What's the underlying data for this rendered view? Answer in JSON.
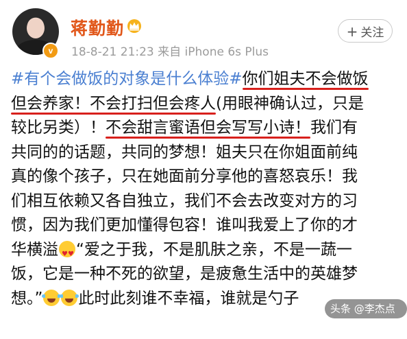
{
  "post": {
    "user_name": "蒋勤勤",
    "verified_badge": "v",
    "crown_icon": "crown-icon",
    "meta": "18-8-21 21:23  来自 iPhone 6s Plus",
    "follow_label": "关注",
    "follow_plus": "+",
    "content": {
      "l1_tag": "#有个会做饭的对象是什么体验#",
      "l1_ul": "你们姐夫不会做饭",
      "l2_ul": "但会养家！不会打扫但会疼人",
      "l2_rest": "(用眼神确认过，只是",
      "l3_a": "较比另类）！",
      "l3_ul": "不会甜言蜜语但会写写小诗！",
      "l3_b": "我们有",
      "l4": "共同的的话题，共同的梦想！姐夫只在你姐面前纯",
      "l5": "真的像个孩子，只在她面前分享他的喜怒哀乐！我",
      "l6": "们相互依赖又各自独立，我们不会去改变对方的习",
      "l7": "惯，因为我们更加懂得包容！谁叫我爱上了你的才",
      "l8_a": "华横溢",
      "l8_b": "“爱之于我，不是肌肤之亲，不是一蔬一",
      "l9": "饭，它是一种不死的欲望，是疲惫生活中的英雄梦",
      "l10_a": "想。”",
      "l10_b": "此时此刻谁不幸福，谁就是勺子"
    }
  },
  "watermark": {
    "text": "头条 @李杰点",
    "icon": "share-icon"
  },
  "colors": {
    "name": "#e1571a",
    "topic": "#4a7fd1",
    "underline": "#d8201c",
    "meta": "#9b9b9b"
  }
}
